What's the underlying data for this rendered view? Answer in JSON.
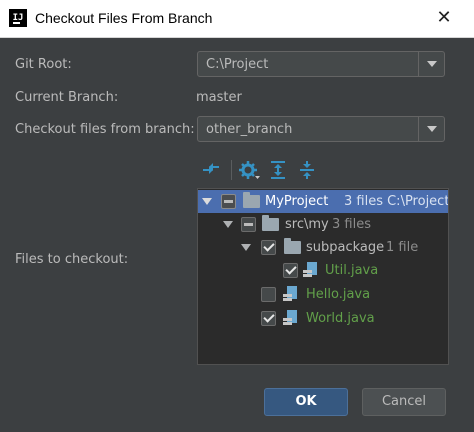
{
  "window": {
    "title": "Checkout Files From Branch",
    "close_symbol": "✕"
  },
  "form": {
    "git_root_label": "Git Root:",
    "git_root_value": "C:\\Project",
    "current_branch_label": "Current Branch:",
    "current_branch_value": "master",
    "checkout_branch_label": "Checkout files from branch:",
    "checkout_branch_value": "other_branch",
    "files_label": "Files to checkout:"
  },
  "toolbar": {
    "icons": [
      "expand-diff-icon",
      "settings-gear-icon",
      "expand-all-icon",
      "collapse-all-icon"
    ]
  },
  "tree": {
    "root": {
      "name": "MyProject",
      "meta": "3 files  C:\\Project",
      "state": "partial"
    },
    "src": {
      "name": "src\\my",
      "meta": "3 files",
      "state": "partial"
    },
    "subpackage": {
      "name": "subpackage",
      "meta": "1 file",
      "state": "checked"
    },
    "util": {
      "name": "Util.java",
      "state": "checked"
    },
    "hello": {
      "name": "Hello.java",
      "state": "unchecked"
    },
    "world": {
      "name": "World.java",
      "state": "checked"
    }
  },
  "buttons": {
    "ok": "OK",
    "cancel": "Cancel"
  },
  "colors": {
    "accent": "#4b6eaf",
    "modified_file": "#62a04a",
    "dialog_bg": "#3c3f41"
  }
}
